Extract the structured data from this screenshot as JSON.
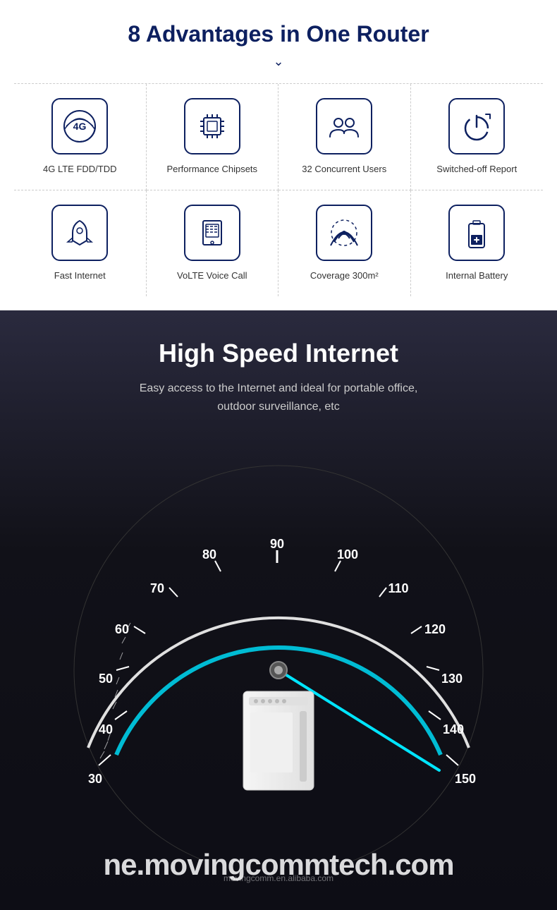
{
  "advantages": {
    "title": "8 Advantages in One Router",
    "items": [
      {
        "id": "4g-lte",
        "label": "4G LTE FDD/TDD",
        "icon": "4g-icon"
      },
      {
        "id": "chipset",
        "label": "Performance Chipsets",
        "icon": "chip-icon"
      },
      {
        "id": "users",
        "label": "32 Concurrent Users",
        "icon": "users-icon"
      },
      {
        "id": "switchedoff",
        "label": "Switched-off Report",
        "icon": "power-icon"
      },
      {
        "id": "fast",
        "label": "Fast Internet",
        "icon": "rocket-icon"
      },
      {
        "id": "volte",
        "label": "VoLTE Voice Call",
        "icon": "phone-icon"
      },
      {
        "id": "coverage",
        "label": "Coverage 300m²",
        "icon": "wifi-icon"
      },
      {
        "id": "battery",
        "label": "Internal Battery",
        "icon": "battery-icon"
      }
    ]
  },
  "speed_section": {
    "title": "High Speed Internet",
    "subtitle_line1": "Easy access to the Internet and ideal for portable office,",
    "subtitle_line2": "outdoor surveillance, etc",
    "speedometer": {
      "marks": [
        "30",
        "40",
        "50",
        "60",
        "70",
        "80",
        "90",
        "100",
        "110",
        "120",
        "130",
        "140",
        "150"
      ],
      "needle_value": 150
    },
    "watermark": "ne.movingcommtech.com",
    "watermark_small": "movingcomm.en.alibaba.com"
  }
}
